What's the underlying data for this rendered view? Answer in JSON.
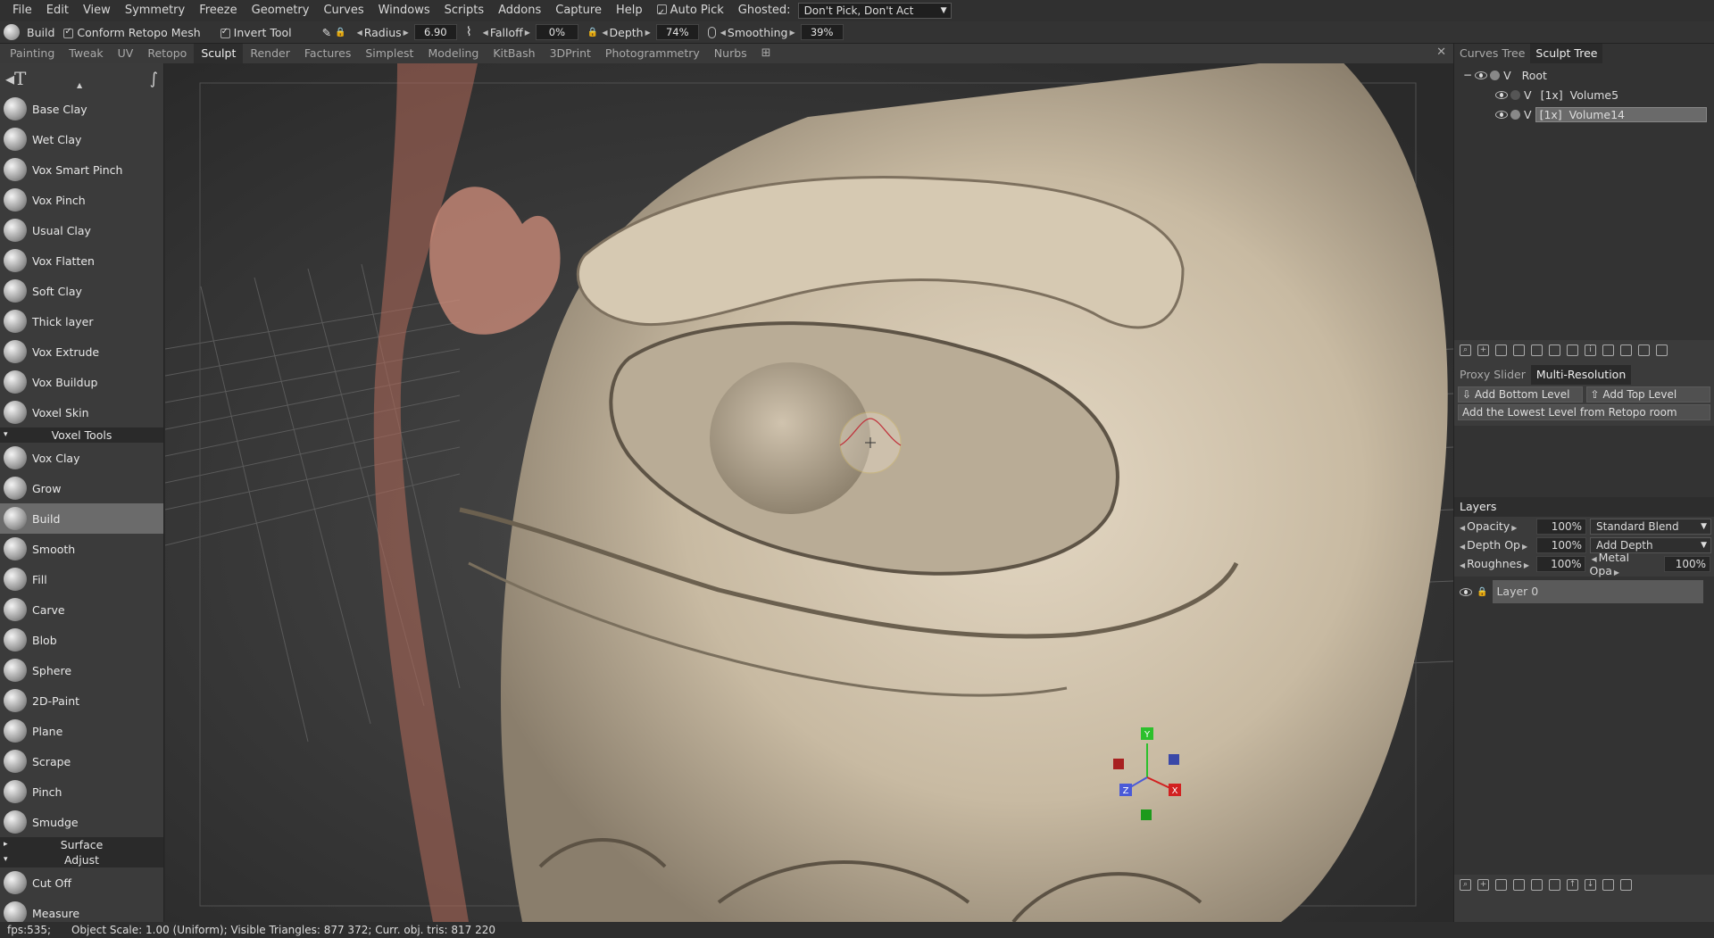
{
  "menubar": {
    "items": [
      "File",
      "Edit",
      "View",
      "Symmetry",
      "Freeze",
      "Geometry",
      "Curves",
      "Windows",
      "Scripts",
      "Addons",
      "Capture",
      "Help"
    ],
    "auto_pick": "Auto Pick",
    "ghosted_label": "Ghosted:",
    "ghosted_value": "Don't Pick, Don't Act"
  },
  "toolbar": {
    "tool_name": "Build",
    "conform": "Conform Retopo Mesh",
    "invert": "Invert Tool",
    "radius_label": "Radius",
    "radius_value": "6.90",
    "falloff_label": "Falloff",
    "falloff_value": "0%",
    "depth_label": "Depth",
    "depth_value": "74%",
    "smoothing_label": "Smoothing",
    "smoothing_value": "39%"
  },
  "rooms": [
    "Painting",
    "Tweak",
    "UV",
    "Retopo",
    "Sculpt",
    "Render",
    "Factures",
    "Simplest",
    "Modeling",
    "KitBash",
    "3DPrint",
    "Photogrammetry",
    "Nurbs"
  ],
  "active_room": "Sculpt",
  "tools_top": [
    "Base Clay",
    "Wet Clay",
    "Vox Smart Pinch",
    "Vox Pinch",
    "Usual Clay",
    "Vox Flatten",
    "Soft Clay",
    "Thick layer",
    "Vox Extrude",
    "Vox Buildup",
    "Voxel Skin"
  ],
  "section_voxel": "Voxel Tools",
  "tools_voxel": [
    "Vox Clay",
    "Grow",
    "Build",
    "Smooth",
    "Fill",
    "Carve",
    "Blob",
    "Sphere",
    "2D-Paint",
    "Plane",
    "Scrape",
    "Pinch",
    "Smudge"
  ],
  "section_surface": "Surface",
  "section_adjust": "Adjust",
  "tools_adjust": [
    "Cut Off",
    "Measure"
  ],
  "right": {
    "tabs": [
      "Curves Tree",
      "Sculpt Tree"
    ],
    "active_tab": "Sculpt Tree",
    "tree": [
      {
        "label": "Root",
        "flag": "V"
      },
      {
        "label": "[1x]  Volume5",
        "flag": "V"
      },
      {
        "label": "[1x]  Volume14",
        "flag": "V"
      }
    ],
    "sub_tabs": [
      "Proxy Slider",
      "Multi-Resolution"
    ],
    "active_sub": "Multi-Resolution",
    "add_bottom": "Add Bottom Level",
    "add_top": "Add Top Level",
    "add_lowest": "Add the Lowest Level from Retopo room",
    "layers_title": "Layers",
    "opacity_label": "Opacity",
    "opacity_value": "100%",
    "blend": "Standard Blend",
    "depth_op_label": "Depth Op",
    "depth_op_value": "100%",
    "depth_mode": "Add Depth",
    "rough_label": "Roughnes",
    "rough_value": "100%",
    "metal_label": "Metal Opa",
    "metal_value": "100%",
    "layer_name": "Layer 0"
  },
  "status": "fps:535;      Object Scale: 1.00 (Uniform); Visible Triangles: 877 372; Curr. obj. tris: 817 220",
  "gizmo": {
    "y": "Y",
    "x": "X",
    "z": "Z"
  }
}
